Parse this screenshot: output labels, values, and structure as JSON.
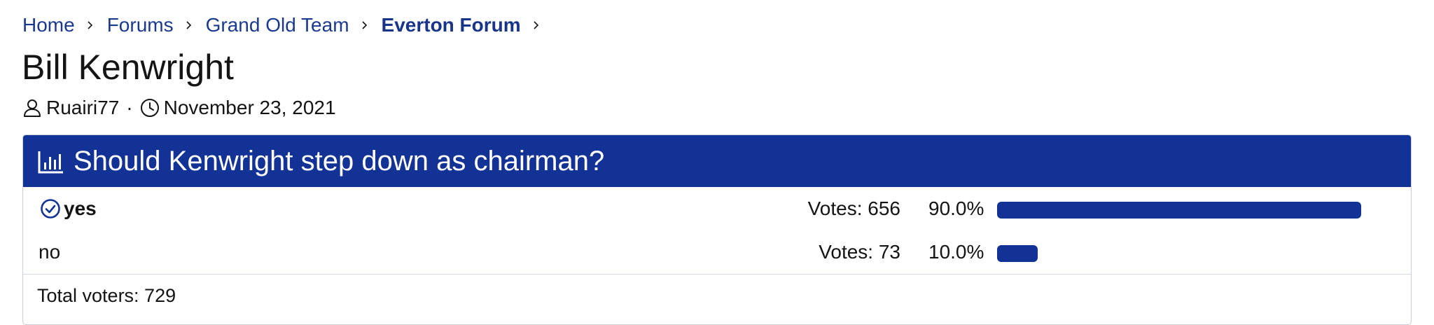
{
  "breadcrumb": {
    "items": [
      {
        "label": "Home"
      },
      {
        "label": "Forums"
      },
      {
        "label": "Grand Old Team"
      },
      {
        "label": "Everton Forum"
      }
    ]
  },
  "thread": {
    "title": "Bill Kenwright",
    "author": "Ruairi77",
    "separator": "·",
    "date": "November 23, 2021"
  },
  "poll": {
    "question": "Should Kenwright step down as chairman?",
    "options": [
      {
        "label": "yes",
        "votes_text": "Votes: 656",
        "percent_text": "90.0%",
        "fraction": 0.9,
        "voted": true
      },
      {
        "label": "no",
        "votes_text": "Votes: 73",
        "percent_text": "10.0%",
        "fraction": 0.1,
        "voted": false
      }
    ],
    "total_voters_text": "Total voters: 729"
  },
  "colors": {
    "accent": "#123296",
    "link": "#1b3a8f"
  },
  "icons": {
    "separator": "chevron-right-icon",
    "author": "user-icon",
    "date": "clock-icon",
    "poll": "bar-chart-icon",
    "voted": "check-circle-icon"
  }
}
